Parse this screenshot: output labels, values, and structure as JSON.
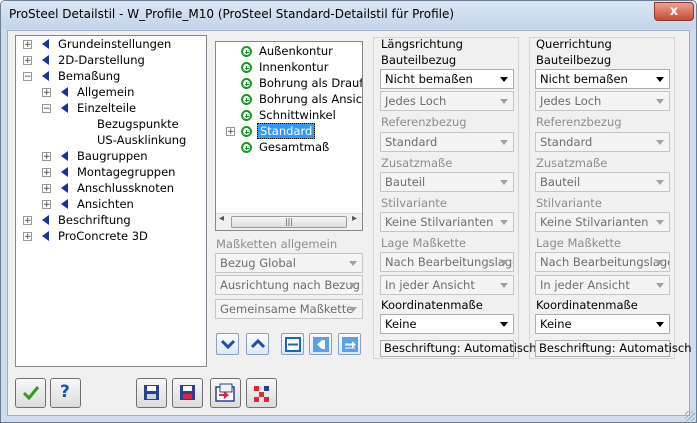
{
  "window": {
    "title": "ProSteel Detailstil - W_Profile_M10 (ProSteel Standard-Detailstil für Profile)",
    "close_label": "x"
  },
  "tree": {
    "items": [
      {
        "label": "Grundeinstellungen",
        "expander": "+"
      },
      {
        "label": "2D-Darstellung",
        "expander": "+"
      },
      {
        "label": "Bemaßung",
        "expander": "−"
      },
      {
        "label": "Allgemein",
        "expander": "+"
      },
      {
        "label": "Einzelteile",
        "expander": "−"
      },
      {
        "label": "Bezugspunkte",
        "expander": ""
      },
      {
        "label": "US-Ausklinkung",
        "expander": ""
      },
      {
        "label": "Baugruppen",
        "expander": "+"
      },
      {
        "label": "Montagegruppen",
        "expander": "+"
      },
      {
        "label": "Anschlussknoten",
        "expander": "+"
      },
      {
        "label": "Ansichten",
        "expander": "+"
      },
      {
        "label": "Beschriftung",
        "expander": "+"
      },
      {
        "label": "ProConcrete 3D",
        "expander": "+"
      }
    ]
  },
  "subtree": {
    "items": [
      {
        "label": "Außenkontur"
      },
      {
        "label": "Innenkontur"
      },
      {
        "label": "Bohrung als Draufsicht"
      },
      {
        "label": "Bohrung als Ansicht"
      },
      {
        "label": "Schnittwinkel"
      },
      {
        "label": "Standard",
        "expander": "+"
      },
      {
        "label": "Gesamtmaß"
      }
    ],
    "scroll_thumb": "|||"
  },
  "chains": {
    "label": "Maßketten allgemein",
    "bezug": "Bezug Global",
    "ausrichtung": "Ausrichtung nach Bezug",
    "gemeinsam": "Gemeinsame Maßkette"
  },
  "longitudinal": {
    "header": "Längsrichtung",
    "bauteilbezug_label": "Bauteilbezug",
    "bauteilbezug": "Nicht bemaßen",
    "loch": "Jedes Loch",
    "referenz_label": "Referenzbezug",
    "referenz": "Standard",
    "zusatz_label": "Zusatzmaße",
    "zusatz": "Bauteil",
    "stil_label": "Stilvariante",
    "stil": "Keine Stilvarianten",
    "lage_label": "Lage Maßkette",
    "lage": "Nach Bearbeitungslage",
    "ansicht": "In jeder Ansicht",
    "koord_label": "Koordinatenmaße",
    "koord": "Keine",
    "beschriftung": "Beschriftung: Automatisch"
  },
  "transverse": {
    "header": "Querrichtung",
    "bauteilbezug_label": "Bauteilbezug",
    "bauteilbezug": "Nicht bemaßen",
    "loch": "Jedes Loch",
    "referenz_label": "Referenzbezug",
    "referenz": "Standard",
    "zusatz_label": "Zusatzmaße",
    "zusatz": "Bauteil",
    "stil_label": "Stilvariante",
    "stil": "Keine Stilvarianten",
    "lage_label": "Lage Maßkette",
    "lage": "Nach Bearbeitungslage",
    "ansicht": "In jeder Ansicht",
    "koord_label": "Koordinatenmaße",
    "koord": "Keine",
    "beschriftung": "Beschriftung: Automatisch"
  },
  "buttons": {
    "help_label": "?"
  },
  "colors": {
    "accent": "#1730a8",
    "selection": "#3399ff",
    "ok_green": "#2f9a1c",
    "close_red": "#c74a33"
  }
}
